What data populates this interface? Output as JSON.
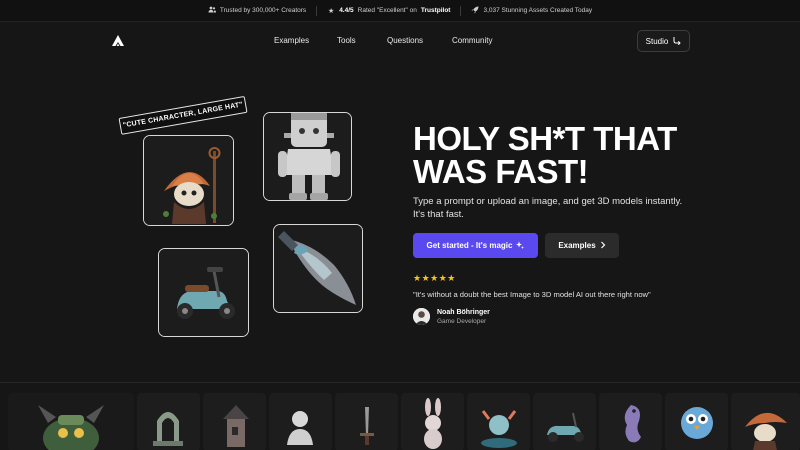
{
  "topbar": {
    "trusted": "Trusted by 300,000+ Creators",
    "rating_score": "4.4/5",
    "rating_text": "Rated \"Excellent\" on",
    "rating_site": "Trustpilot",
    "assets": "3,037 Stunning Assets Created Today"
  },
  "nav": {
    "links": [
      "Examples",
      "Tools",
      "Questions",
      "Community"
    ],
    "studio_label": "Studio"
  },
  "hero": {
    "tag": "\"CUTE CHARACTER, LARGE HAT\"",
    "headline_line1": "HOLY SH*T THAT",
    "headline_line2": "WAS FAST!",
    "subtext": "Type a prompt or upload an image, and get 3D models instantly. It's that fast.",
    "primary_cta": "Get started - It's magic",
    "secondary_cta": "Examples",
    "stars": "★★★★★",
    "rating": 5,
    "quote": "\"It's without a doubt the best Image to 3D model AI out there right now\"",
    "author": "Noah Böhringer",
    "role": "Game Developer"
  },
  "colors": {
    "background": "#161616",
    "accent": "#5b49f0",
    "star": "#f5c518"
  },
  "icons": [
    "user-group-icon",
    "star-icon",
    "rocket-icon",
    "logo-icon",
    "studio-arrow-icon",
    "sparkle-icon",
    "chevron-right-icon"
  ]
}
